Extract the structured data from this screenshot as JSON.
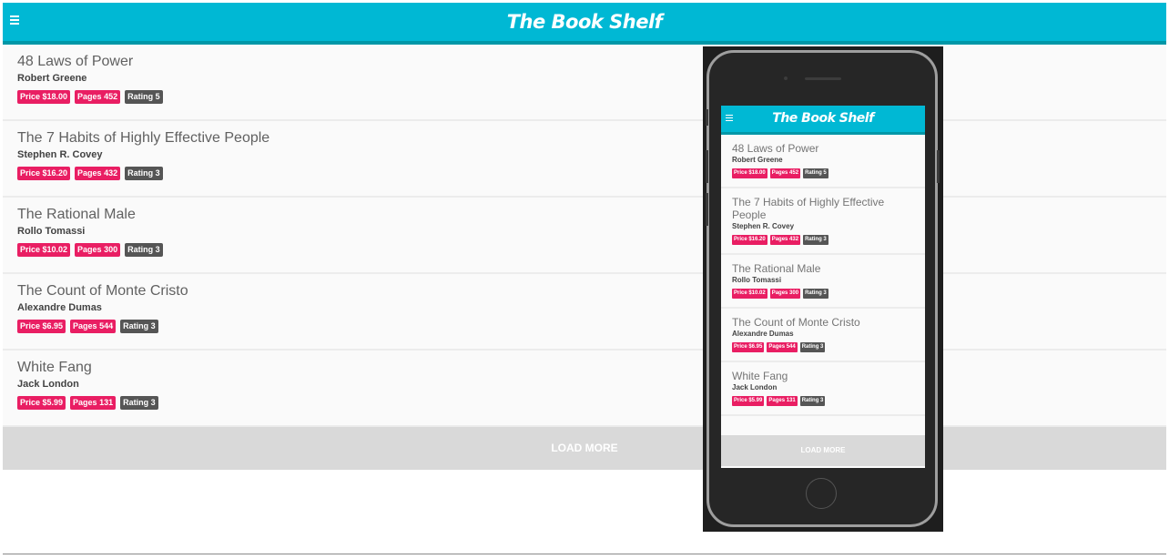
{
  "app": {
    "title": "The Book Shelf",
    "load_more": "LOAD MORE"
  },
  "books": [
    {
      "title": "48 Laws of Power",
      "author": "Robert Greene",
      "price": "Price $18.00",
      "pages": "Pages 452",
      "rating": "Rating 5"
    },
    {
      "title": "The 7 Habits of Highly Effective People",
      "author": "Stephen R. Covey",
      "price": "Price $16.20",
      "pages": "Pages 432",
      "rating": "Rating 3"
    },
    {
      "title": "The Rational Male",
      "author": "Rollo Tomassi",
      "price": "Price $10.02",
      "pages": "Pages 300",
      "rating": "Rating 3"
    },
    {
      "title": "The Count of Monte Cristo",
      "author": "Alexandre Dumas",
      "price": "Price $6.95",
      "pages": "Pages 544",
      "rating": "Rating 3"
    },
    {
      "title": "White Fang",
      "author": "Jack London",
      "price": "Price $5.99",
      "pages": "Pages 131",
      "rating": "Rating 3"
    }
  ],
  "mobile": {
    "title": "The Book Shelf",
    "load_more": "LOAD MORE",
    "books": [
      {
        "title": "48 Laws of Power",
        "author": "Robert Greene",
        "price": "Price $18.00",
        "pages": "Pages 452",
        "rating": "Rating 5"
      },
      {
        "title": "The 7 Habits of Highly Effective People",
        "author": "Stephen R. Covey",
        "price": "Price $16.20",
        "pages": "Pages 432",
        "rating": "Rating 3"
      },
      {
        "title": "The Rational Male",
        "author": "Rollo Tomassi",
        "price": "Price $10.02",
        "pages": "Pages 300",
        "rating": "Rating 3"
      },
      {
        "title": "The Count of Monte Cristo",
        "author": "Alexandre Dumas",
        "price": "Price $6.95",
        "pages": "Pages 544",
        "rating": "Rating 3"
      },
      {
        "title": "White Fang",
        "author": "Jack London",
        "price": "Price $5.99",
        "pages": "Pages 131",
        "rating": "Rating 3"
      }
    ]
  },
  "colors": {
    "accent": "#00b8d4",
    "accent_dark": "#0097a7",
    "badge_pink": "#e91e63",
    "badge_gray": "#555555"
  },
  "icons": {
    "menu": "hamburger-menu-icon"
  }
}
